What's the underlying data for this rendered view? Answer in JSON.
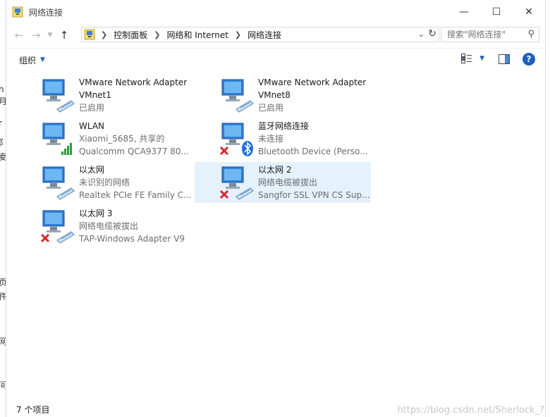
{
  "window": {
    "title": "网络连接",
    "controls": {
      "minimize": "—",
      "maximize": "☐",
      "close": "✕"
    }
  },
  "address": {
    "crumbs": [
      "控制面板",
      "网络和 Internet",
      "网络连接"
    ]
  },
  "search": {
    "placeholder": "搜索\"网络连接\""
  },
  "toolbar": {
    "organize_label": "组织"
  },
  "connections": [
    {
      "name": "VMware Network Adapter VMnet1",
      "line1": "VMnet1",
      "line2": "已启用",
      "title": "VMware Network Adapter",
      "status_icon": "none"
    },
    {
      "name": "VMware Network Adapter VMnet8",
      "line1": "VMnet8",
      "line2": "已启用",
      "title": "VMware Network Adapter",
      "status_icon": "none"
    },
    {
      "title": "WLAN",
      "line1": "Xiaomi_5685, 共享的",
      "line2": "Qualcomm QCA9377 80...",
      "status_icon": "wifi-signal"
    },
    {
      "title": "蓝牙网络连接",
      "line1": "未连接",
      "line2": "Bluetooth Device (Perso...",
      "status_icon": "bluetooth-disconnected"
    },
    {
      "title": "以太网",
      "line1": "未识别的网络",
      "line2": "Realtek PCIe FE Family C...",
      "status_icon": "none"
    },
    {
      "title": "以太网 2",
      "line1": "网络电缆被拔出",
      "line2": "Sangfor SSL VPN CS Sup...",
      "status_icon": "disconnected",
      "selected": true
    },
    {
      "title": "以太网 3",
      "line1": "网络电缆被拔出",
      "line2": "TAP-Windows Adapter V9",
      "status_icon": "disconnected"
    }
  ],
  "status": {
    "item_count": "7 个项目"
  },
  "watermark": "https://blog.csdn.net/Sherlock_?",
  "colors": {
    "accent": "#1e5fbf",
    "selected_bg": "#e5f1fb",
    "error_red": "#d9262b",
    "signal_green": "#2e9a3a"
  },
  "left_fragments": [
    "n",
    "月",
    "r",
    "阝",
    "夌",
    "页",
    "件",
    "网",
    "间"
  ]
}
